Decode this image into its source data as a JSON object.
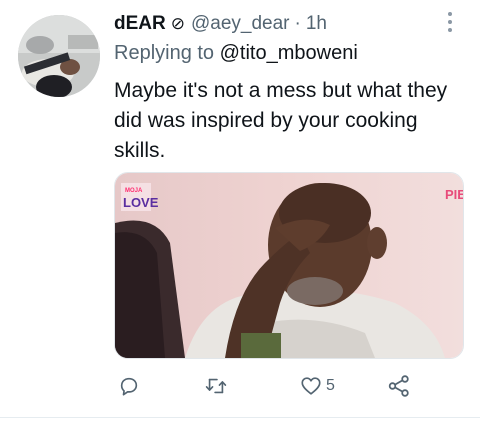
{
  "tweet": {
    "display_name": "dEAR",
    "name_glyph": "⊘",
    "handle": "@aey_dear",
    "separator": "·",
    "time": "1h",
    "reply_prefix": "Replying to",
    "reply_to": "@tito_mboweni",
    "text": "Maybe it's not a mess but what they did was inspired by your cooking skills.",
    "media": {
      "logo_top": "MOJA",
      "logo_main": "LOVE",
      "corner_text": "PIE"
    },
    "actions": {
      "reply_icon": "reply-icon",
      "retweet_icon": "retweet-icon",
      "like_icon": "heart-icon",
      "like_count": "5",
      "share_icon": "share-icon"
    }
  },
  "colors": {
    "text_primary": "#0f1419",
    "text_secondary": "#536471",
    "icon": "#536471",
    "divider": "#e6ecf0",
    "logo_pink": "#ff2d6f",
    "logo_purple": "#5a2ea0"
  }
}
